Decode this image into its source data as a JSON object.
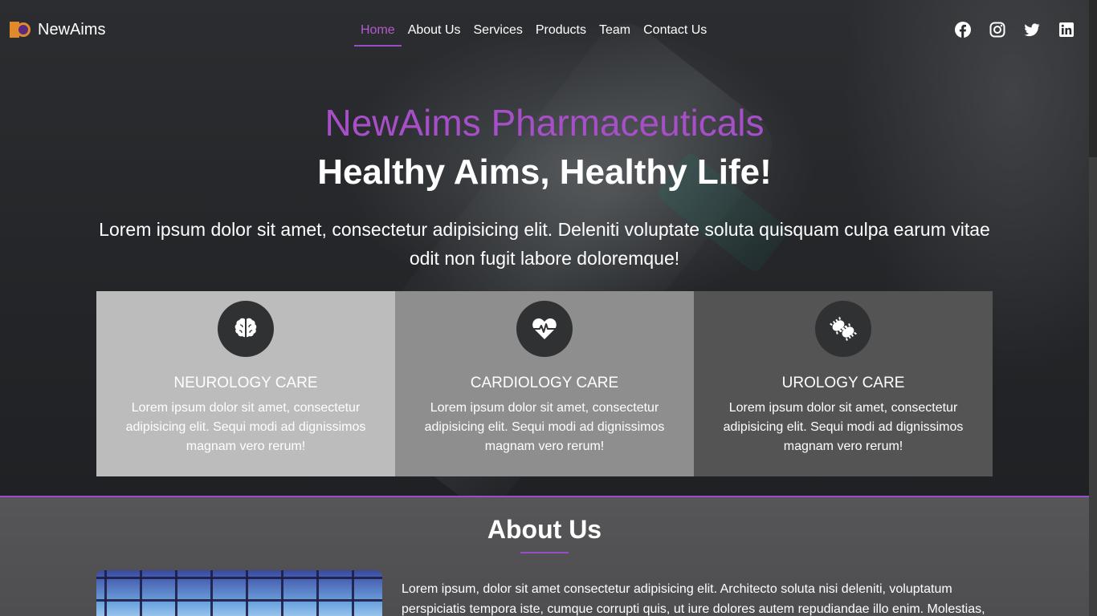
{
  "brand": {
    "name": "NewAims"
  },
  "nav": {
    "items": [
      {
        "label": "Home",
        "active": true
      },
      {
        "label": "About Us"
      },
      {
        "label": "Services"
      },
      {
        "label": "Products"
      },
      {
        "label": "Team"
      },
      {
        "label": "Contact Us"
      }
    ]
  },
  "socials": [
    "facebook-icon",
    "instagram-icon",
    "twitter-icon",
    "linkedin-icon"
  ],
  "hero": {
    "title": "NewAims Pharmaceuticals",
    "subtitle": "Healthy Aims, Healthy Life!",
    "description": "Lorem ipsum dolor sit amet, consectetur adipisicing elit. Deleniti voluptate soluta quisquam culpa earum vitae odit non fugit labore doloremque!"
  },
  "cards": [
    {
      "icon": "brain-icon",
      "title": "NEUROLOGY CARE",
      "text": "Lorem ipsum dolor sit amet, consectetur adipisicing elit. Sequi modi ad dignissimos magnam vero rerum!"
    },
    {
      "icon": "heartbeat-icon",
      "title": "CARDIOLOGY CARE",
      "text": "Lorem ipsum dolor sit amet, consectetur adipisicing elit. Sequi modi ad dignissimos magnam vero rerum!"
    },
    {
      "icon": "bacteria-icon",
      "title": "UROLOGY CARE",
      "text": "Lorem ipsum dolor sit amet, consectetur adipisicing elit. Sequi modi ad dignissimos magnam vero rerum!"
    }
  ],
  "about": {
    "title": "About Us",
    "text": "Lorem ipsum, dolor sit amet consectetur adipisicing elit. Architecto soluta nisi deleniti, voluptatum perspiciatis tempora iste, cumque corrupti quis, ut iure dolores autem repudiandae illo enim. Molestias,"
  },
  "colors": {
    "accent": "#a64fc8",
    "card1": "#bcbcbc",
    "card2": "#8e8e8e",
    "card3": "#545455"
  }
}
